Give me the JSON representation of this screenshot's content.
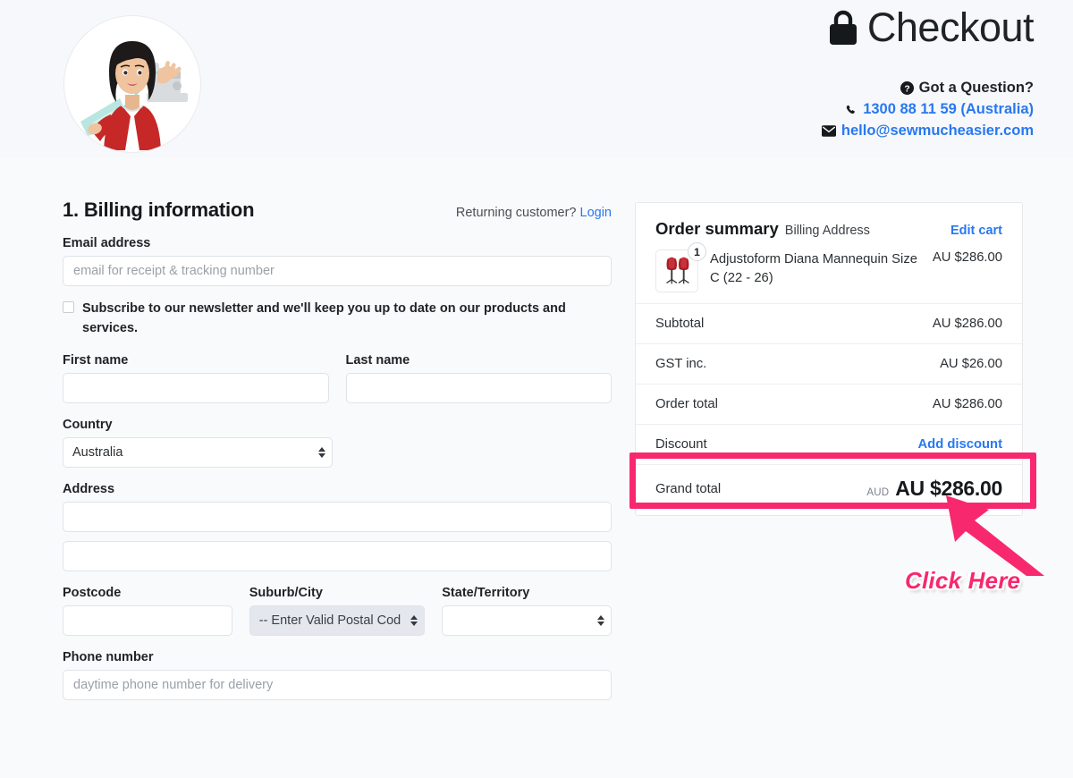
{
  "header": {
    "title": "Checkout",
    "lock_icon": "lock-icon",
    "help_title": "Got a Question?",
    "help_icon": "question-circle-icon",
    "phone_icon": "phone-icon",
    "phone": "1300 88 11 59 (Australia)",
    "email_icon": "envelope-icon",
    "email": "hello@sewmucheasier.com",
    "logo_alt": "sew-much-easier-logo"
  },
  "billing": {
    "section_title": "1. Billing information",
    "returning_text": "Returning customer?",
    "login_label": "Login",
    "email_label": "Email address",
    "email_placeholder": "email for receipt & tracking number",
    "email_value": "",
    "newsletter_text": "Subscribe to our newsletter and we'll keep you up to date on our products and services.",
    "newsletter_checked": false,
    "first_name_label": "First name",
    "first_name_value": "",
    "last_name_label": "Last name",
    "last_name_value": "",
    "country_label": "Country",
    "country_value": "Australia",
    "address_label": "Address",
    "address1_value": "",
    "address2_value": "",
    "postcode_label": "Postcode",
    "postcode_value": "",
    "suburb_label": "Suburb/City",
    "suburb_value": "-- Enter Valid Postal Cod",
    "state_label": "State/Territory",
    "state_value": "",
    "phone_label": "Phone number",
    "phone_placeholder": "daytime phone number for delivery",
    "phone_value": ""
  },
  "summary": {
    "title": "Order summary",
    "subtitle": "Billing Address",
    "edit_cart_label": "Edit cart",
    "item": {
      "name": "Adjustoform Diana Mannequin Size C (22 - 26)",
      "price": "AU $286.00",
      "qty": "1",
      "thumb_alt": "mannequin-thumbnail"
    },
    "lines": [
      {
        "label": "Subtotal",
        "value": "AU $286.00"
      },
      {
        "label": "GST inc.",
        "value": "AU $26.00"
      },
      {
        "label": "Order total",
        "value": "AU $286.00"
      }
    ],
    "discount_label": "Discount",
    "add_discount_label": "Add discount",
    "grand_label": "Grand total",
    "grand_currency": "AUD",
    "grand_value": "AU $286.00"
  },
  "annotation": {
    "click_here_label": "Click Here",
    "highlight_color": "#f8286e",
    "arrow_icon": "arrow-up-left-icon"
  },
  "colors": {
    "page_bg": "#f7f8fa",
    "panel_bg": "#ffffff",
    "link_blue": "#2878f0",
    "accent_pink": "#f8286e",
    "text": "#2b2f33"
  }
}
